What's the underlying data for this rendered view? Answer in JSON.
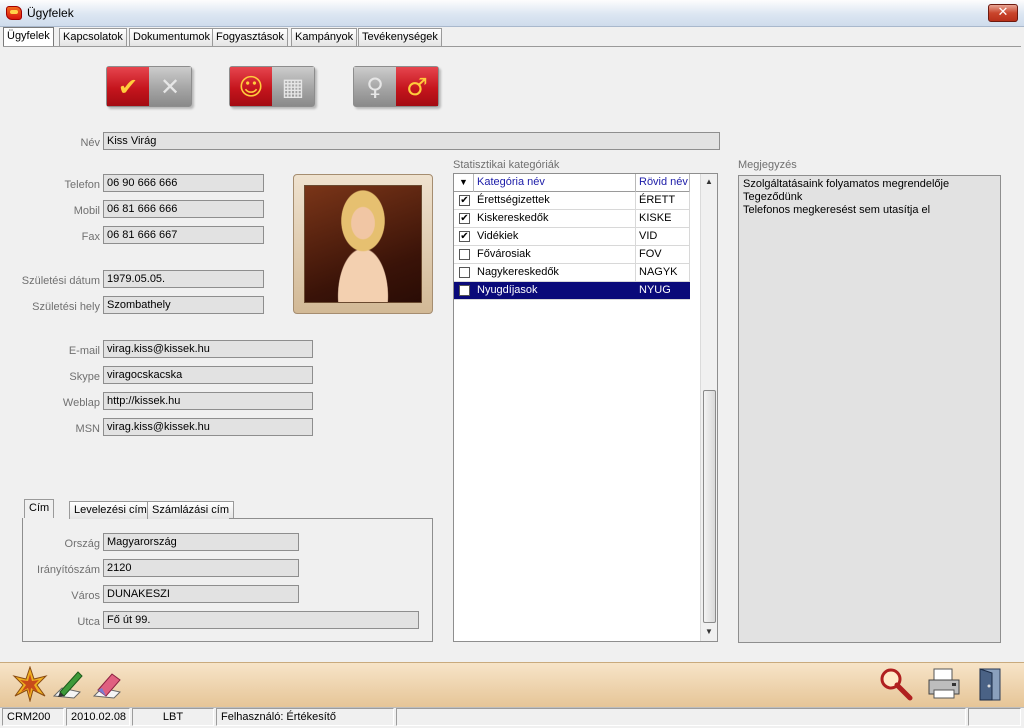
{
  "window": {
    "title": "Ügyfelek",
    "close_symbol": "✕"
  },
  "tabs": [
    "Ügyfelek",
    "Kapcsolatok",
    "Dokumentumok",
    "Fogyasztások",
    "Kampányok",
    "Tevékenységek"
  ],
  "toggles": {
    "status": {
      "on_icon": "✔",
      "off_icon": "✕",
      "on_name": "check-icon",
      "off_name": "cross-icon"
    },
    "type": {
      "on_icon": "☺",
      "off_icon": "▦",
      "on_name": "smiley-icon",
      "off_name": "building-icon"
    },
    "gender": {
      "on_icon": "♀",
      "off_icon": "♂",
      "on_name": "female-icon",
      "off_name": "male-icon"
    }
  },
  "form": {
    "nev_label": "Név",
    "nev": "Kiss Virág",
    "telefon_label": "Telefon",
    "telefon": "06 90 666 666",
    "mobil_label": "Mobil",
    "mobil": "06 81 666 666",
    "fax_label": "Fax",
    "fax": "06 81 666 667",
    "szuletesi_datum_label": "Születési dátum",
    "szuletesi_datum": "1979.05.05.",
    "szuletesi_hely_label": "Születési hely",
    "szuletesi_hely": "Szombathely",
    "email_label": "E-mail",
    "email": "virag.kiss@kissek.hu",
    "skype_label": "Skype",
    "skype": "viragocskacska",
    "weblap_label": "Weblap",
    "weblap": "http://kissek.hu",
    "msn_label": "MSN",
    "msn": "virag.kiss@kissek.hu"
  },
  "categories": {
    "label": "Statisztikai kategóriák",
    "col_name": "Kategória név",
    "col_short": "Rövid név",
    "rows": [
      {
        "checked": "✔",
        "name": "Érettségizettek",
        "short": "ÉRETT"
      },
      {
        "checked": "✔",
        "name": "Kiskereskedők",
        "short": "KISKE"
      },
      {
        "checked": "✔",
        "name": "Vidékiek",
        "short": "VID"
      },
      {
        "checked": "",
        "name": "Fővárosiak",
        "short": "FOV"
      },
      {
        "checked": "",
        "name": "Nagykereskedők",
        "short": "NAGYK"
      },
      {
        "checked": "",
        "name": "Nyugdíjasok",
        "short": "NYUG"
      }
    ]
  },
  "notes": {
    "label": "Megjegyzés",
    "lines": [
      "Szolgáltatásaink folyamatos megrendelője",
      "Tegeződünk",
      "Telefonos megkeresést sem utasítja el"
    ]
  },
  "address": {
    "tabs": [
      "Cím",
      "Levelezési cím",
      "Számlázási cím"
    ],
    "orszag_label": "Ország",
    "orszag": "Magyarország",
    "iranyitoszam_label": "Irányítószám",
    "iranyitoszam": "2120",
    "varos_label": "Város",
    "varos": "DUNAKESZI",
    "utca_label": "Utca",
    "utca": "Fő út 99."
  },
  "statusbar": {
    "app": "CRM200",
    "date": "2010.02.08",
    "code": "LBT",
    "user": "Felhasználó: Értékesítő"
  }
}
